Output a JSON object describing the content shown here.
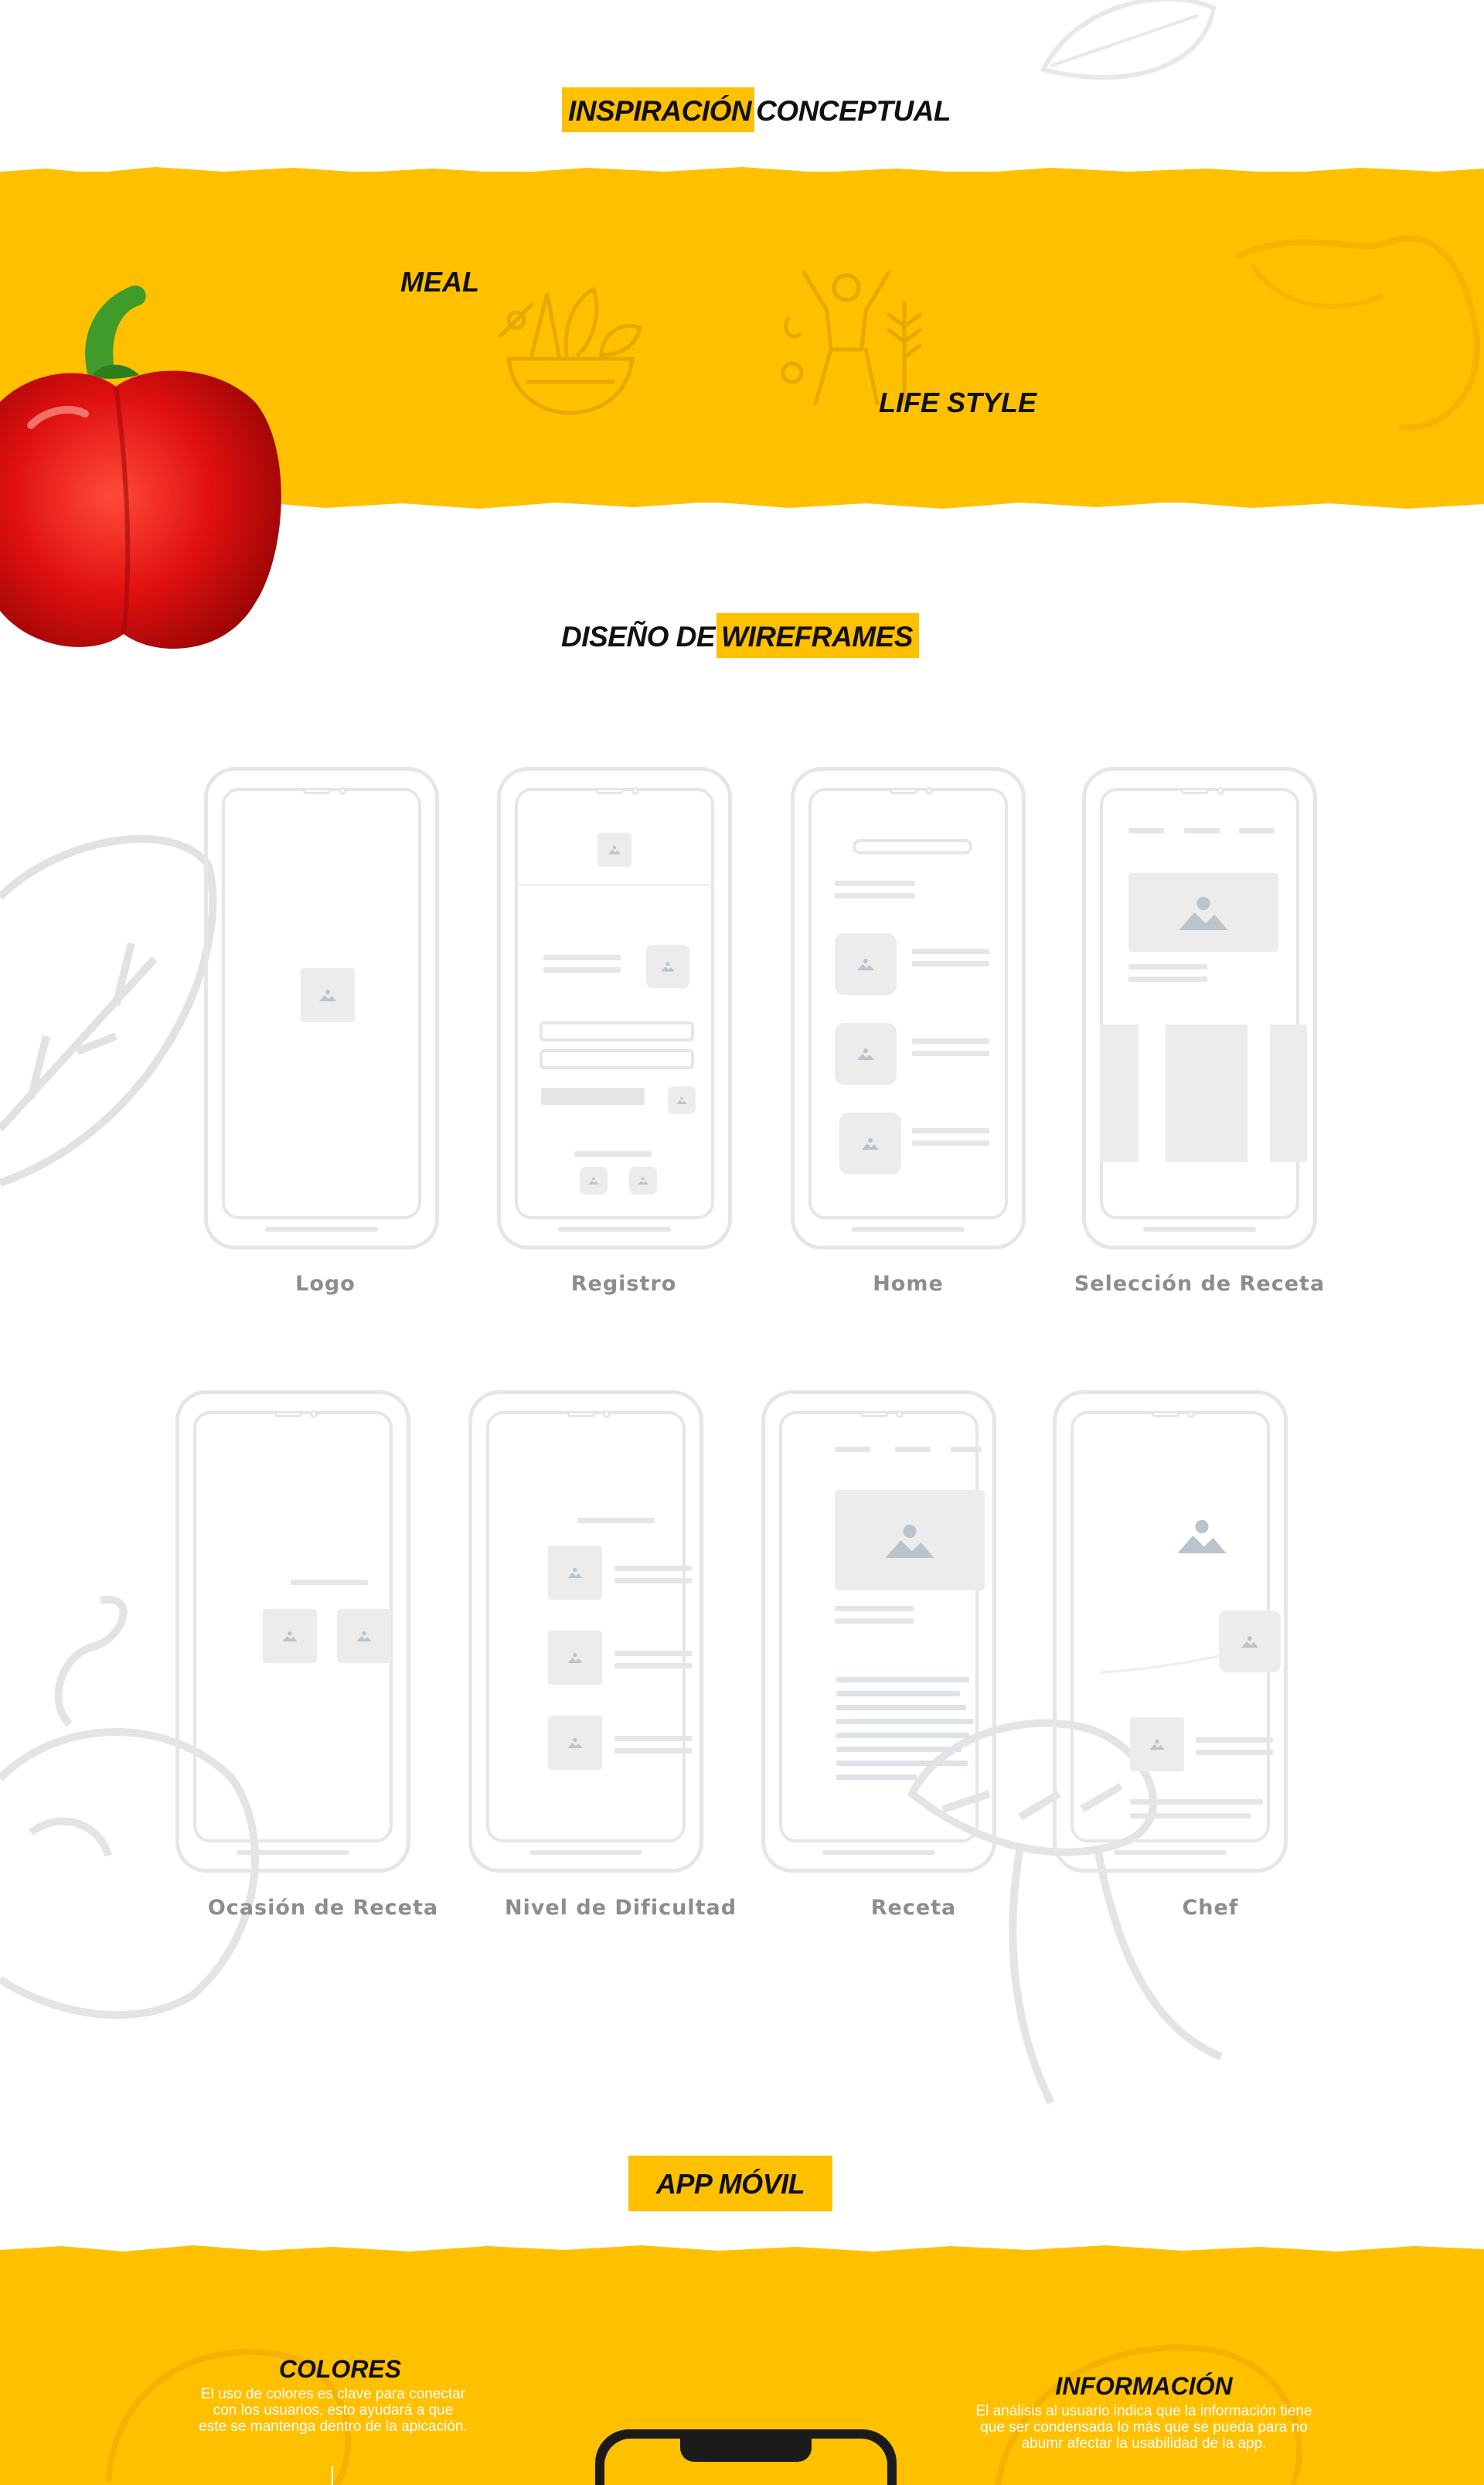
{
  "sections": {
    "inspiracion": {
      "title_highlight": "INSPIRACIÓN",
      "title_rest": "CONCEPTUAL"
    },
    "concepts": {
      "meal": "MEAL",
      "lifestyle": "LIFE STYLE"
    },
    "wireframes": {
      "title_plain": "DISEÑO DE",
      "title_highlight": "WIREFRAMES"
    },
    "app": {
      "title": "APP MÓVIL"
    }
  },
  "wireframes": [
    {
      "label": "Logo"
    },
    {
      "label": "Registro"
    },
    {
      "label": "Home"
    },
    {
      "label": "Selección de Receta"
    },
    {
      "label": "Ocasión de Receta"
    },
    {
      "label": "Nivel de Dificultad"
    },
    {
      "label": "Receta"
    },
    {
      "label": "Chef"
    }
  ],
  "app_info": {
    "colores": {
      "title": "COLORES",
      "text": "El uso de colores es clave para conectar con los usuarios, esto ayudará a que este se mantenga dentro de la apicación."
    },
    "informacion": {
      "title": "INFORMACIÓN",
      "text": "El análisis al usuario indica que la información tiene que ser condensada lo más que se pueda para no abumr afectar la usabilidad de la app."
    }
  },
  "colors": {
    "accent": "#ffc000",
    "wire": "#e6e6e6",
    "label": "#8d8d8d"
  },
  "icons": [
    "salad-bowl-icon",
    "lifestyle-person-icon",
    "image-placeholder-icon"
  ]
}
